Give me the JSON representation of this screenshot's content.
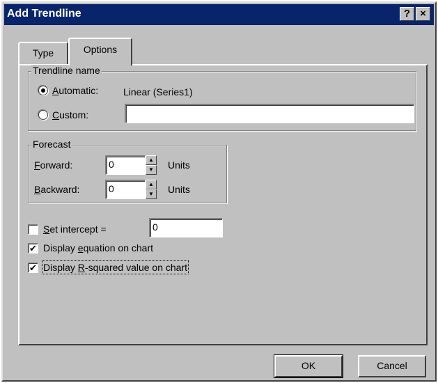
{
  "window": {
    "title": "Add Trendline",
    "help_button": "?",
    "close_button": "×"
  },
  "tabs": [
    {
      "label": "Type",
      "active": false
    },
    {
      "label": "Options",
      "active": true
    }
  ],
  "trendline_name": {
    "group_label": "Trendline name",
    "automatic": {
      "label_first": "A",
      "label_rest": "utomatic:",
      "value": "Linear (Series1)",
      "selected": true
    },
    "custom": {
      "label_first": "C",
      "label_rest": "ustom:",
      "value": "",
      "selected": false
    }
  },
  "forecast": {
    "group_label": "Forecast",
    "forward": {
      "label_first": "F",
      "label_rest": "orward:",
      "value": "0",
      "unit": "Units"
    },
    "backward": {
      "label_first": "B",
      "label_rest": "ackward:",
      "value": "0",
      "unit": "Units"
    }
  },
  "options": {
    "set_intercept": {
      "label_first": "S",
      "label_rest": "et intercept =",
      "checked": false,
      "value": "0"
    },
    "display_equation": {
      "label_before": "Display ",
      "label_u": "e",
      "label_after": "quation on chart",
      "checked": true
    },
    "display_r_squared": {
      "label_before": "Display ",
      "label_u": "R",
      "label_after": "-squared value on chart",
      "checked": true
    }
  },
  "buttons": {
    "ok": "OK",
    "cancel": "Cancel"
  },
  "colors": {
    "titlebar": "#08246b",
    "dialog_face": "#c0c0c0"
  }
}
